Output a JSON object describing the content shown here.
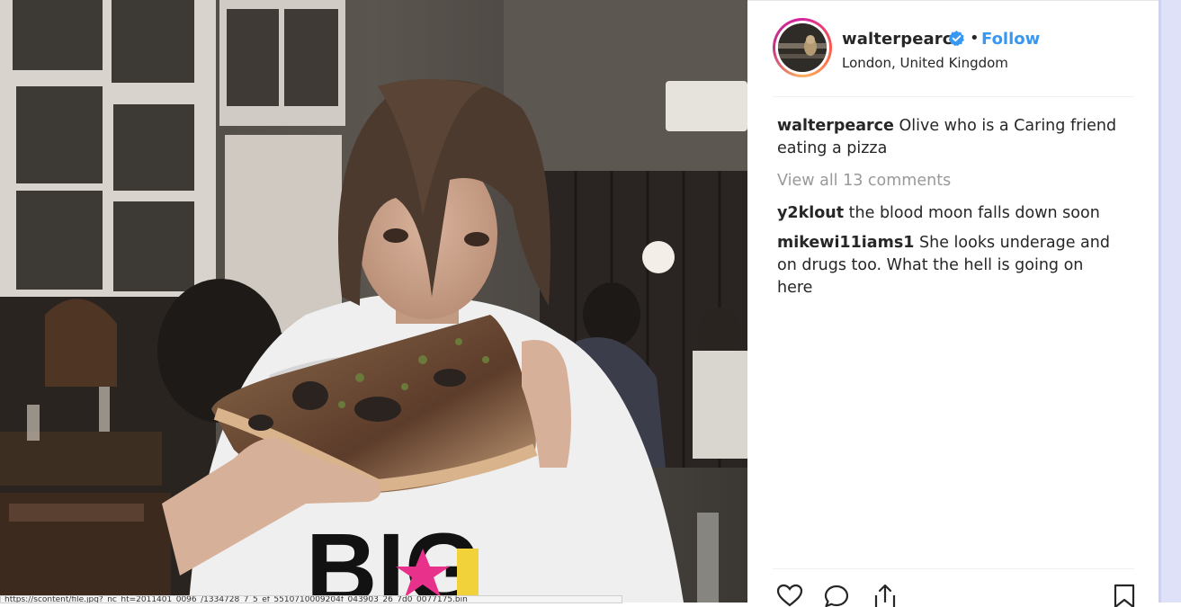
{
  "post": {
    "photo": {
      "description_icon": "post-photo",
      "sweatshirt_text": "BIG"
    }
  },
  "header": {
    "username": "walterpearce",
    "separator": "•",
    "follow_label": "Follow",
    "location": "London, United Kingdom",
    "verified_icon": "verified-badge-icon"
  },
  "caption": {
    "username": "walterpearce",
    "text": "Olive who is a Caring friend eating a pizza"
  },
  "view_all_label": "View all 13 comments",
  "comments": [
    {
      "username": "y2klout",
      "text": "the blood moon falls down soon"
    },
    {
      "username": "mikewi11iams1",
      "text": "She looks underage and on drugs too. What the hell is going on here"
    }
  ],
  "actions": {
    "like_icon": "heart-icon",
    "comment_icon": "comment-icon",
    "share_icon": "share-icon",
    "save_icon": "bookmark-icon"
  },
  "status_url": "https://scontent/file.jpg?_nc_ht=2011401_0096_/1334728_7_5_ef_5510710009204f_043903_26_7d0_0077175.bin",
  "colors": {
    "link": "#3897f0",
    "text": "#262626",
    "muted": "#999999",
    "verified": "#3897f0"
  }
}
